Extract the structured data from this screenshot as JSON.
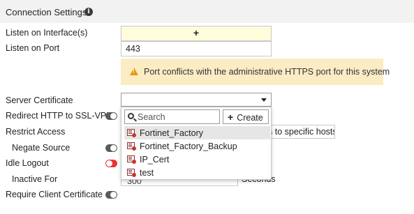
{
  "header": {
    "title": "Connection Settings",
    "info_icon": "info-circle-icon"
  },
  "fields": {
    "listen_interface": {
      "label": "Listen on Interface(s)",
      "add_symbol": "+"
    },
    "listen_port": {
      "label": "Listen on Port",
      "value": "443"
    },
    "warning": {
      "icon": "warning-triangle-icon",
      "text": "Port conflicts with the administrative HTTPS port for this system"
    },
    "server_certificate": {
      "label": "Server Certificate"
    },
    "redirect_http": {
      "label": "Redirect HTTP to SSL-VPN",
      "enabled": false
    },
    "restrict_access": {
      "label": "Restrict Access",
      "option_partial": "s to specific hosts"
    },
    "negate_source": {
      "label": "Negate Source",
      "enabled": false
    },
    "idle_logout": {
      "label": "Idle Logout",
      "enabled": true
    },
    "inactive_for": {
      "label": "Inactive For",
      "value_partial": "300",
      "units": "Seconds"
    },
    "require_client_cert": {
      "label": "Require Client Certificate",
      "enabled": false
    }
  },
  "dropdown": {
    "search_placeholder": "Search",
    "create_label": "Create",
    "create_symbol": "+",
    "options": [
      {
        "name": "Fortinet_Factory",
        "selected": true
      },
      {
        "name": "Fortinet_Factory_Backup",
        "selected": false
      },
      {
        "name": "IP_Cert",
        "selected": false
      },
      {
        "name": "test",
        "selected": false
      }
    ]
  },
  "colors": {
    "accent_toggle_on": "#e9332f",
    "warning_bg": "#fbecc4",
    "warning_icon": "#e39a0b",
    "interface_bg": "#fefcdb"
  }
}
